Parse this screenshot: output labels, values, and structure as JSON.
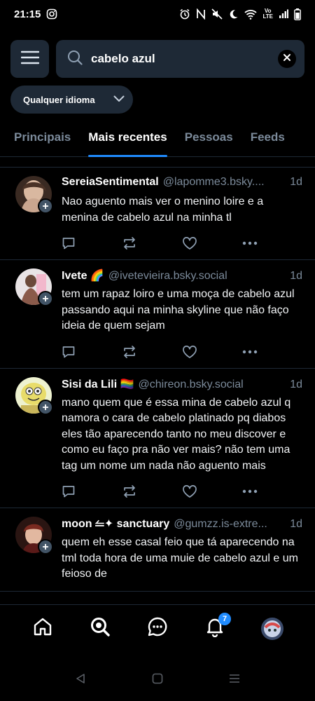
{
  "status_bar": {
    "time": "21:15",
    "volte": "Vo\nLTE"
  },
  "search": {
    "query": "cabelo azul"
  },
  "language_filter": {
    "label": "Qualquer idioma"
  },
  "tabs": [
    {
      "label": "Principais",
      "active": false
    },
    {
      "label": "Mais recentes",
      "active": true
    },
    {
      "label": "Pessoas",
      "active": false
    },
    {
      "label": "Feeds",
      "active": false
    }
  ],
  "posts": [
    {
      "name": "SereiaSentimental",
      "handle": "@lapomme3.bsky....",
      "time": "1d",
      "text": "Nao aguento mais ver o menino loire e a menina de cabelo azul na minha tl"
    },
    {
      "name": "Ivete 🌈",
      "handle": "@ivetevieira.bsky.social",
      "time": "1d",
      "text": "tem um rapaz loiro e uma moça de cabelo azul passando aqui na minha skyline que não faço ideia de quem sejam"
    },
    {
      "name": "Sisi da Lili 🏳️‍🌈",
      "handle": "@chireon.bsky.social",
      "time": "1d",
      "text": "mano quem que é essa mina de cabelo azul q namora o cara de cabelo platinado pq diabos eles tão aparecendo tanto no meu discover e como eu faço pra não ver mais? não tem uma tag um nome um nada não aguento mais"
    },
    {
      "name": "moon ⥪✦ sanctuary",
      "handle": "@gumzz.is-extre...",
      "time": "1d",
      "text": "quem eh esse casal feio que tá aparecendo na tml toda hora de uma muie de cabelo azul e um feioso de"
    }
  ],
  "bottom_nav": {
    "notifications_badge": "7"
  },
  "colors": {
    "accent": "#208bfe",
    "panel": "#1e2936",
    "muted": "#7b8a9a",
    "background": "#000000"
  },
  "icons": {
    "status_bar": [
      "instagram-icon",
      "alarm-icon",
      "nfc-icon",
      "mute-icon",
      "dnd-moon-icon",
      "wifi-icon",
      "signal-icon",
      "battery-icon"
    ],
    "post_actions": [
      "reply-icon",
      "repost-icon",
      "like-icon",
      "more-icon"
    ],
    "bottom_nav": [
      "home-icon",
      "search-icon",
      "chat-icon",
      "bell-icon",
      "profile-avatar"
    ],
    "system_nav": [
      "back-icon",
      "home-square-icon",
      "recents-icon"
    ]
  }
}
